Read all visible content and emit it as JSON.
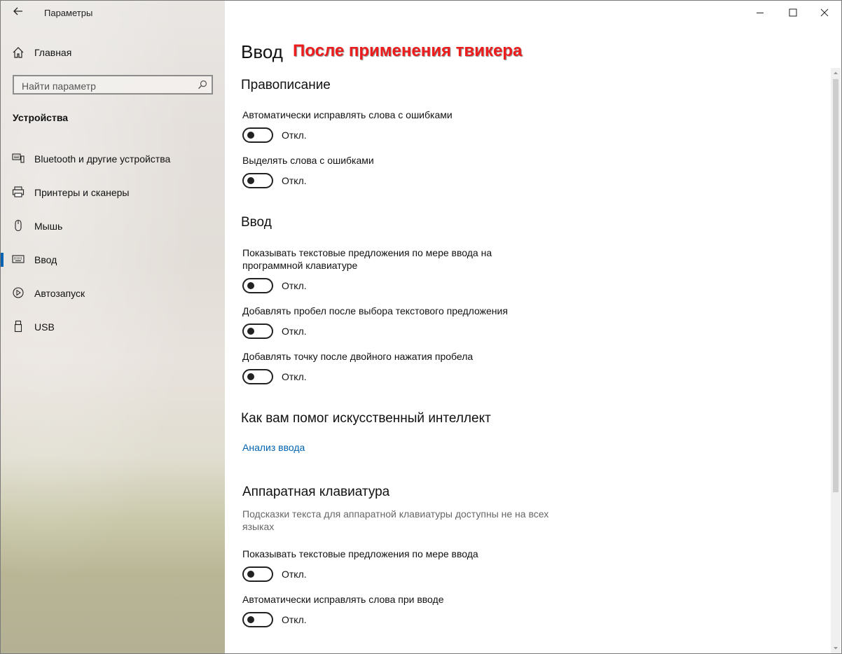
{
  "window": {
    "app_title": "Параметры",
    "controls": [
      "minimize-icon",
      "maximize-icon",
      "close-icon"
    ]
  },
  "sidebar": {
    "home_label": "Главная",
    "search_placeholder": "Найти параметр",
    "section_label": "Устройства",
    "items": [
      {
        "label": "Bluetooth и другие устройства",
        "icon": "bluetooth-devices-icon"
      },
      {
        "label": "Принтеры и сканеры",
        "icon": "printer-icon"
      },
      {
        "label": "Мышь",
        "icon": "mouse-icon"
      },
      {
        "label": "Ввод",
        "icon": "keyboard-icon",
        "active": true
      },
      {
        "label": "Автозапуск",
        "icon": "autoplay-icon"
      },
      {
        "label": "USB",
        "icon": "usb-icon"
      }
    ],
    "accent_color": "#0063b1"
  },
  "content": {
    "page_title": "Ввод",
    "annotation": "После применения твикера",
    "spelling": {
      "heading": "Правописание",
      "settings": [
        {
          "label": "Автоматически исправлять слова с ошибками",
          "state": "Откл."
        },
        {
          "label": "Выделять слова с ошибками",
          "state": "Откл."
        }
      ]
    },
    "typing": {
      "heading": "Ввод",
      "settings": [
        {
          "label": "Показывать текстовые предложения по мере ввода на программной клавиатуре",
          "state": "Откл."
        },
        {
          "label": "Добавлять пробел после выбора текстового предложения",
          "state": "Откл."
        },
        {
          "label": "Добавлять точку после двойного нажатия пробела",
          "state": "Откл."
        }
      ]
    },
    "ai": {
      "heading": "Как вам помог искусственный интеллект",
      "link": "Анализ ввода"
    },
    "hardware": {
      "heading": "Аппаратная клавиатура",
      "note": "Подсказки текста для аппаратной клавиатуры доступны не на всех языках",
      "settings": [
        {
          "label": "Показывать текстовые предложения по мере ввода",
          "state": "Откл."
        },
        {
          "label": "Автоматически исправлять слова при вводе",
          "state": "Откл."
        }
      ]
    },
    "annotation_color": "#ee1c1c",
    "link_color": "#0063b1"
  }
}
